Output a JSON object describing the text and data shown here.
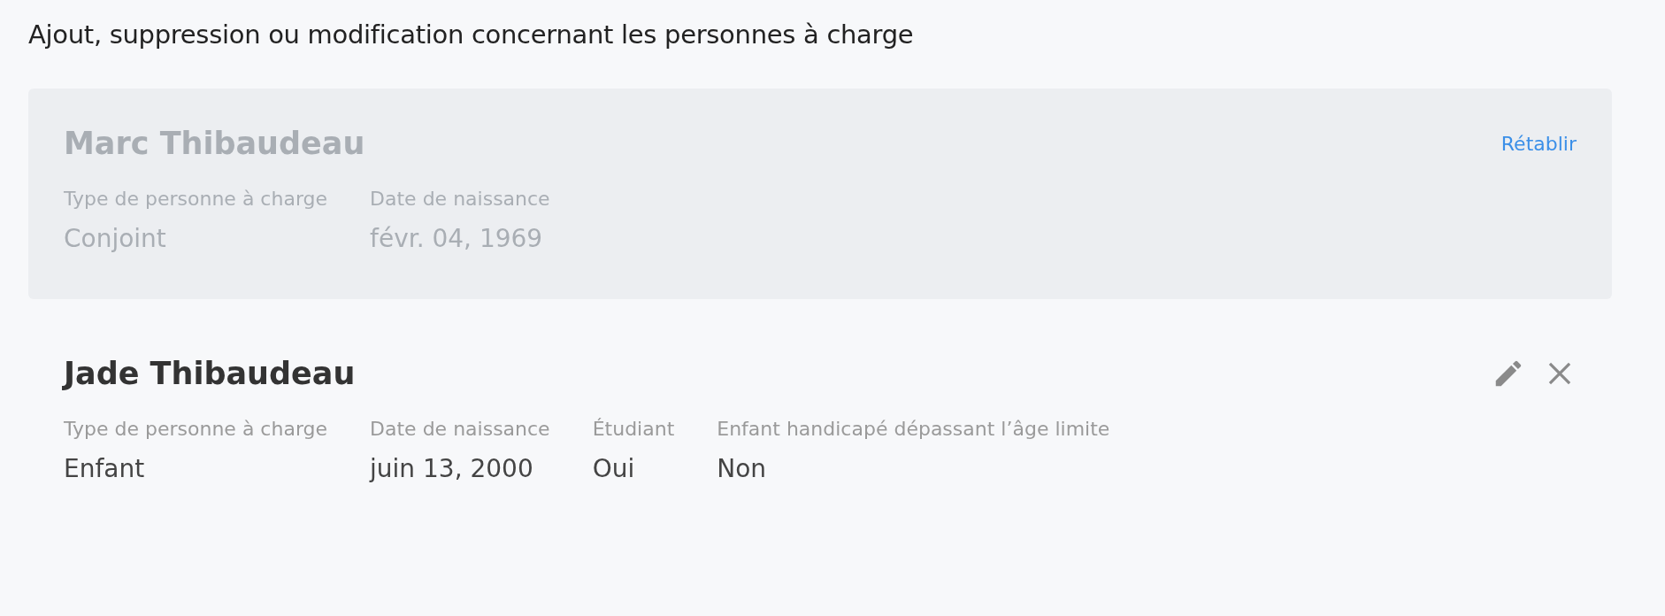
{
  "title": "Ajout, suppression ou modification concernant les personnes à charge",
  "dependents": [
    {
      "name": "Marc Thibaudeau",
      "removed": true,
      "restore_link": "Rétablir",
      "fields": [
        {
          "label": "Type de personne à charge",
          "value": "Conjoint"
        },
        {
          "label": "Date de naissance",
          "value": "févr. 04, 1969"
        }
      ]
    },
    {
      "name": "Jade Thibaudeau",
      "removed": false,
      "fields": [
        {
          "label": "Type de personne à charge",
          "value": "Enfant"
        },
        {
          "label": "Date de naissance",
          "value": "juin 13, 2000"
        },
        {
          "label": "Étudiant",
          "value": "Oui"
        },
        {
          "label": "Enfant handicapé dépassant l’âge limite",
          "value": "Non"
        }
      ]
    }
  ]
}
